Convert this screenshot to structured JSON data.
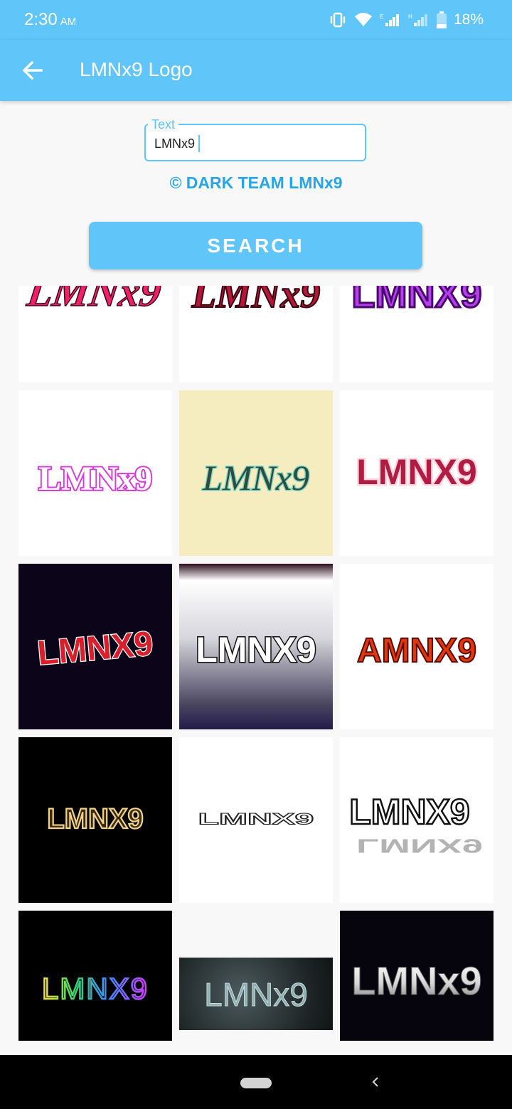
{
  "status_bar": {
    "time": "2:30",
    "ampm": "AM",
    "battery": "18%",
    "icons": [
      "vibrate-icon",
      "wifi-icon",
      "signal-icon",
      "signal-icon",
      "battery-icon"
    ]
  },
  "app_bar": {
    "title": "LMNx9 Logo",
    "back_icon": "arrow-left-icon"
  },
  "text_field": {
    "label": "Text",
    "value": "LMNx9"
  },
  "credit": "© DARK TEAM LMNx9",
  "search_button": {
    "label": "SEARCH"
  },
  "logo_grid": [
    {
      "text": "LMNx9",
      "style": "pink-script"
    },
    {
      "text": "LMNx9",
      "style": "maroon-outline"
    },
    {
      "text": "LMNX9",
      "style": "purple-bold"
    },
    {
      "text": "LMNx9",
      "style": "pink-glow"
    },
    {
      "text": "LMNx9",
      "style": "green-script-on-cream"
    },
    {
      "text": "LMNX9",
      "style": "crimson-bold"
    },
    {
      "text": "LMNX9",
      "style": "red-glitter-on-dark"
    },
    {
      "text": "LMNX9",
      "style": "white-graffiti-gradient"
    },
    {
      "text": "AMNX9",
      "style": "fire"
    },
    {
      "text": "LMNX9",
      "style": "gold-outline-on-black"
    },
    {
      "text": "LMNX9",
      "style": "stretched-3d"
    },
    {
      "text": "LMNX9",
      "style": "sketch-shadow"
    },
    {
      "text": "LMNX9",
      "style": "rainbow-outline-on-black"
    },
    {
      "text": "LMNx9",
      "style": "ice-on-smoke"
    },
    {
      "text": "LMNx9",
      "style": "silver-on-black"
    }
  ],
  "nav_bar": {
    "home_icon": "home-pill-icon",
    "back_icon": "chevron-left-icon"
  },
  "colors": {
    "primary": "#60c5f9",
    "credit": "#26a6e6",
    "background": "#f8f8f8"
  }
}
